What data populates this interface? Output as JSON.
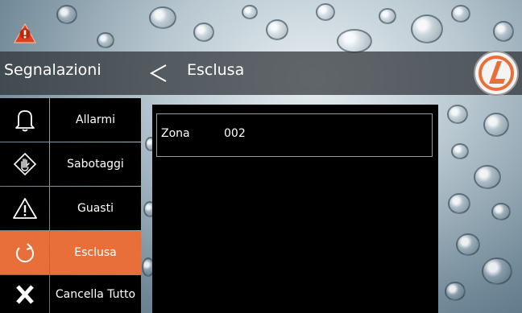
{
  "header": {
    "title": "Segnalazioni",
    "subtitle": "Esclusa"
  },
  "sidebar": {
    "items": [
      {
        "label": "Allarmi",
        "icon": "bell-icon"
      },
      {
        "label": "Sabotaggi",
        "icon": "hand-icon"
      },
      {
        "label": "Guasti",
        "icon": "warning-icon"
      },
      {
        "label": "Esclusa",
        "icon": "exclude-arrow-icon",
        "active": true
      },
      {
        "label": "Cancella Tutto",
        "icon": "x-icon"
      }
    ]
  },
  "zone": {
    "label": "Zona",
    "number": "002"
  },
  "colors": {
    "accent": "#e96f3a",
    "header_bg": "#2d3034",
    "panel_bg": "#000000",
    "alert": "#d9401f"
  }
}
